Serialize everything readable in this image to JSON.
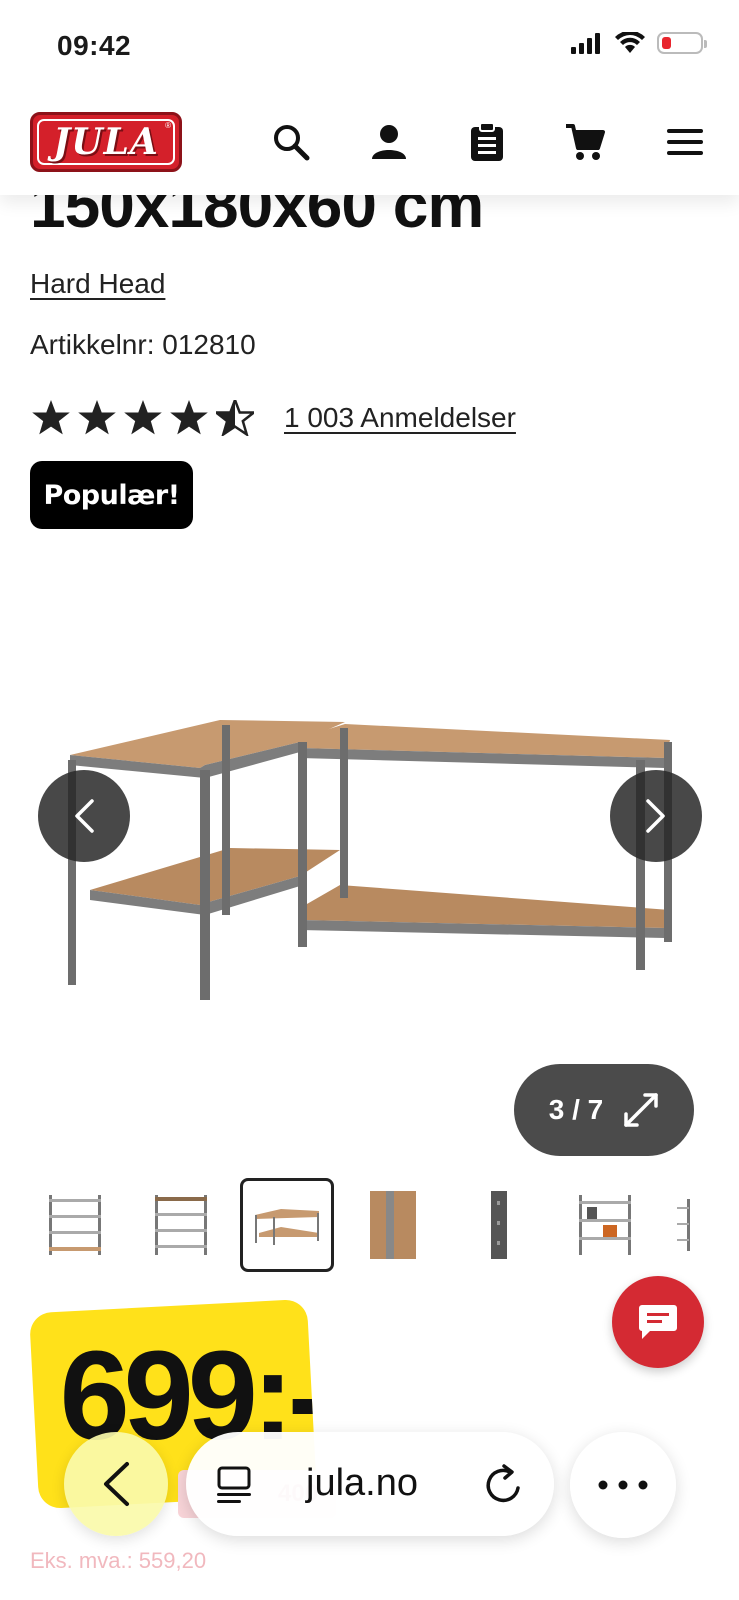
{
  "status_bar": {
    "time": "09:42"
  },
  "header": {
    "logo_text": "JULA"
  },
  "product": {
    "title_partial": "150x180x60 cm",
    "brand": "Hard Head",
    "article_label": "Artikkelnr: 012810",
    "rating_value": 4.5,
    "reviews_label": "1 003 Anmeldelser",
    "badge": "Populær!"
  },
  "gallery": {
    "counter": "3 / 7"
  },
  "price": {
    "current": "699:-",
    "old_partial": "400",
    "ex_vat": "Eks. mva.: 559,20"
  },
  "browser": {
    "url": "jula.no"
  },
  "colors": {
    "brand_red": "#d4202a",
    "price_yellow": "#ffe11a",
    "badge_black": "#000000"
  }
}
